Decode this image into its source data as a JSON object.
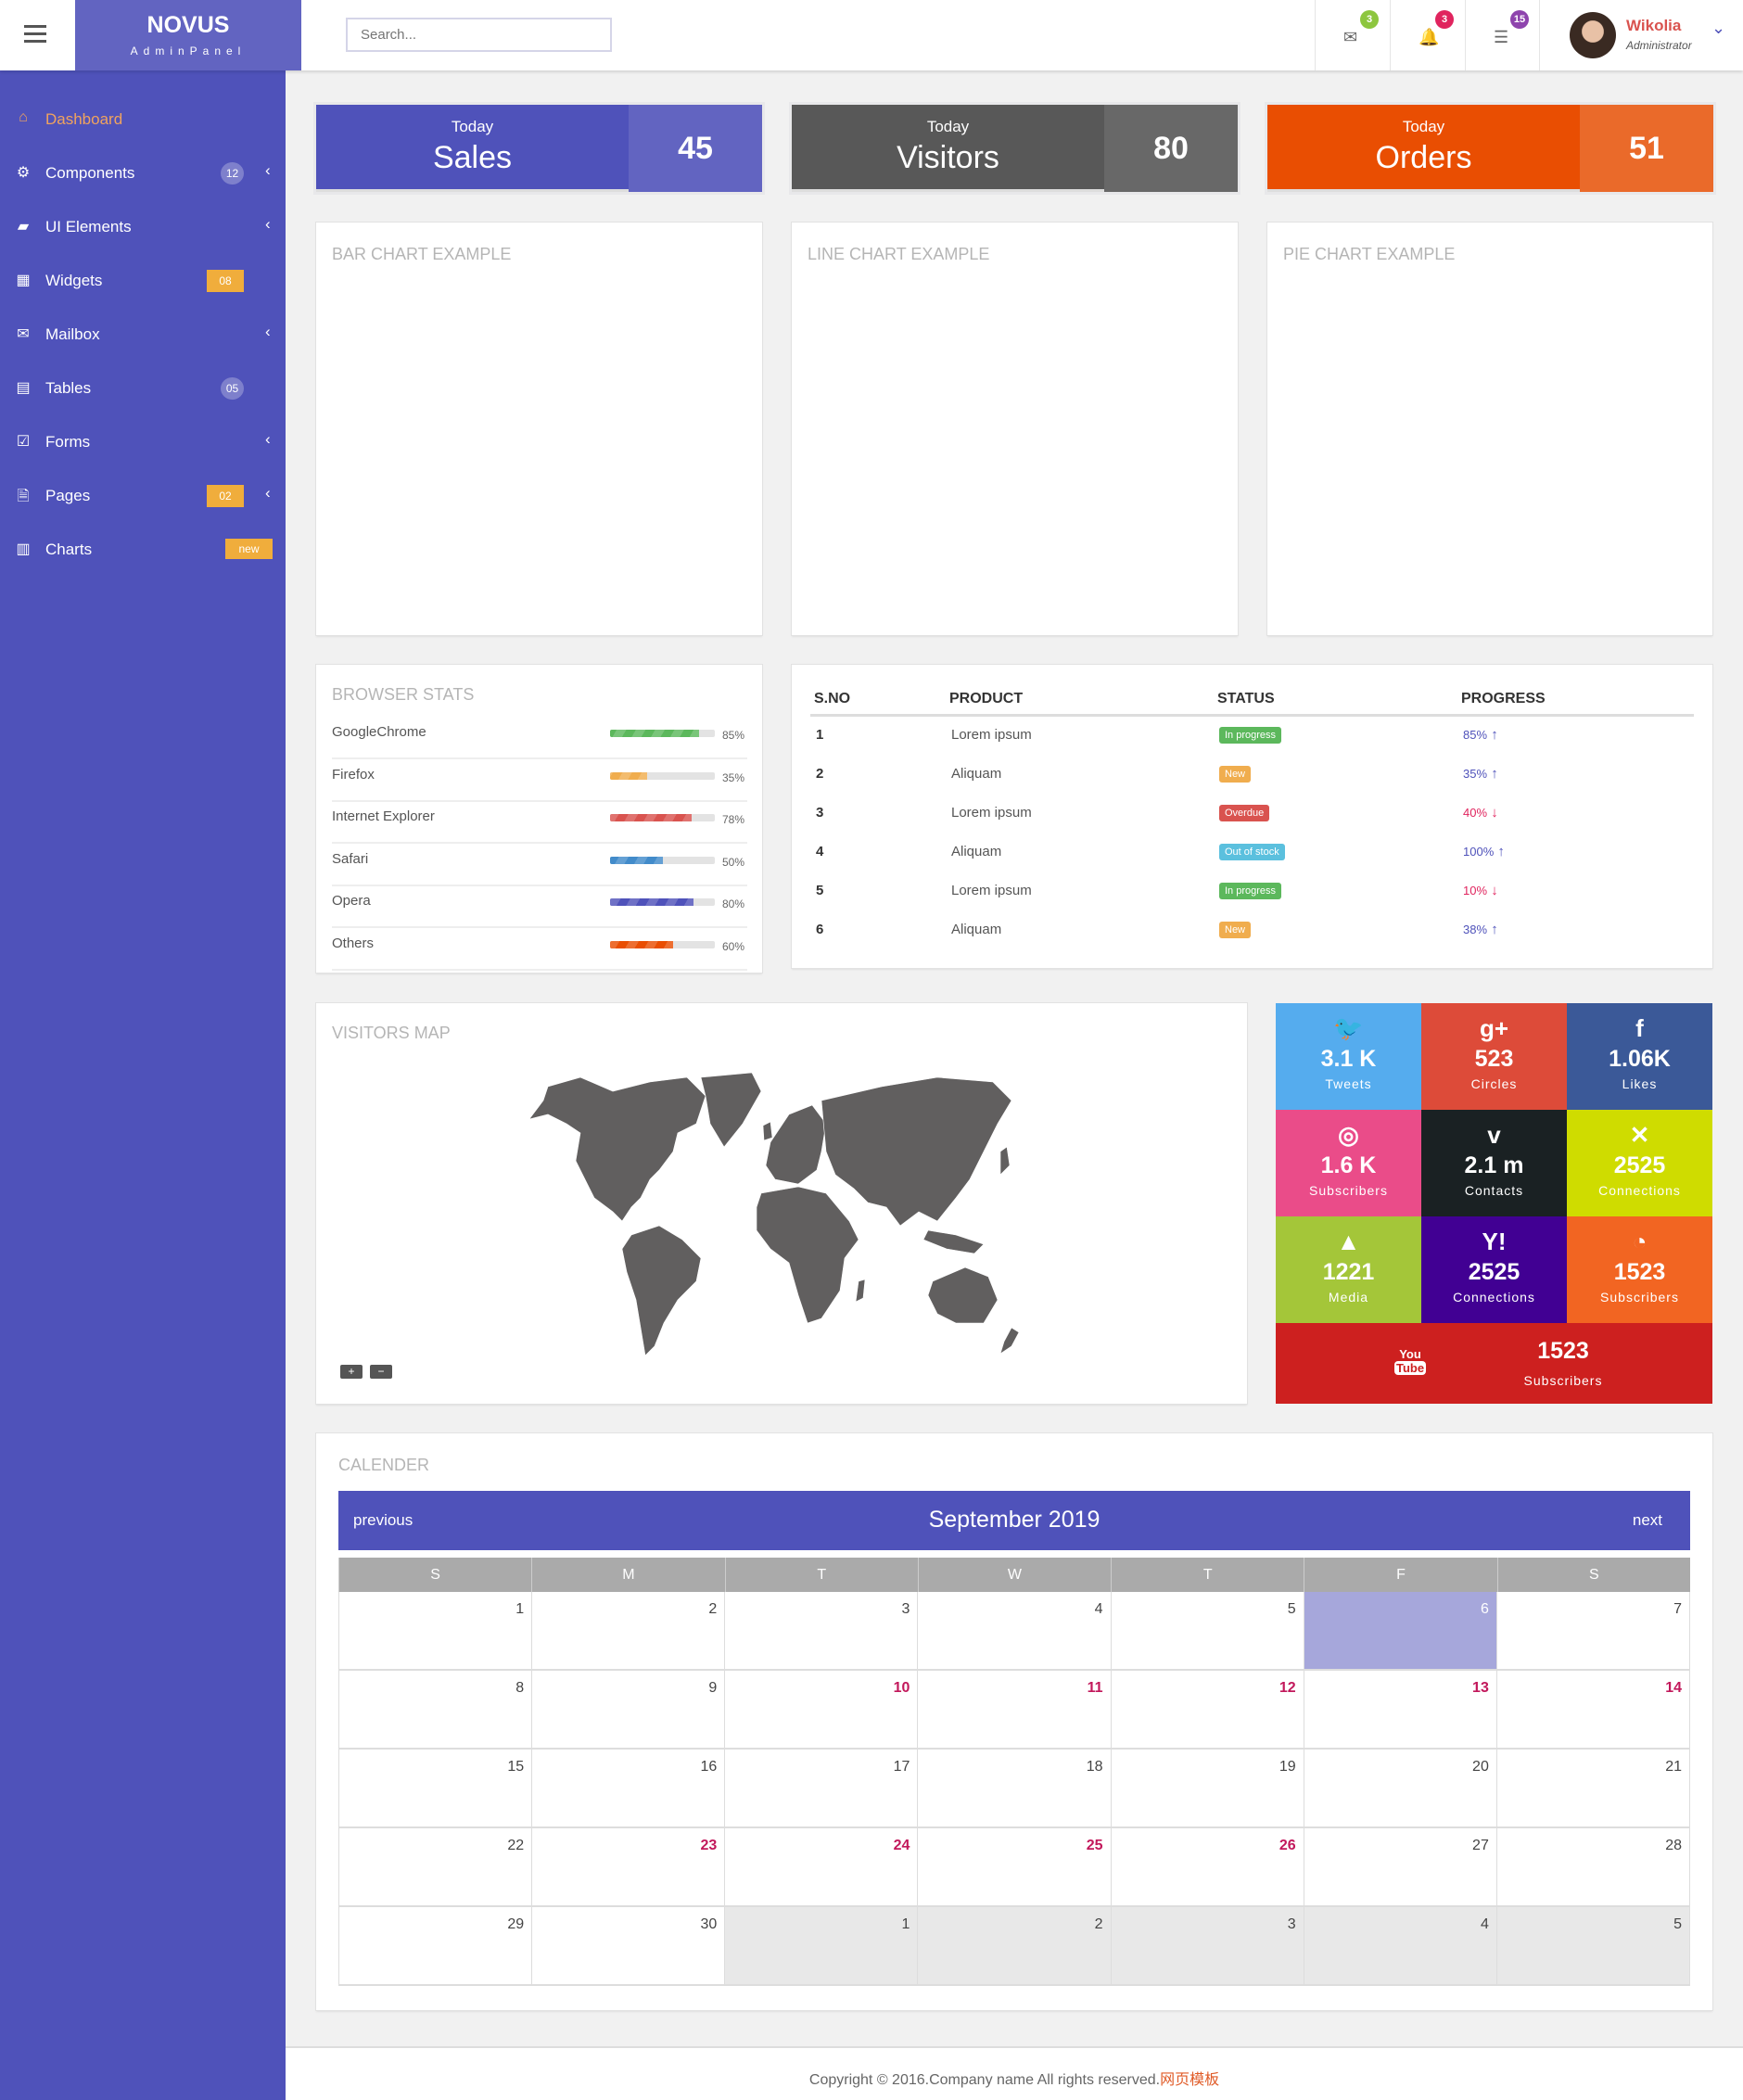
{
  "header": {
    "logo_title": "NOVUS",
    "logo_subtitle": "AdminPanel",
    "search_placeholder": "Search...",
    "notifications": [
      {
        "icon": "envelope-icon",
        "count": "3",
        "color": "#8dc63f"
      },
      {
        "icon": "bell-icon",
        "count": "3",
        "color": "#e0245e"
      },
      {
        "icon": "tasks-icon",
        "count": "15",
        "color": "#8e44ad"
      }
    ],
    "user": {
      "name": "Wikolia",
      "role": "Administrator"
    }
  },
  "sidebar": {
    "items": [
      {
        "label": "Dashboard",
        "icon": "home-icon",
        "active": true
      },
      {
        "label": "Components",
        "icon": "cogs-icon",
        "badge": "12",
        "badge_style": "round",
        "chevron": true
      },
      {
        "label": "UI Elements",
        "icon": "book-icon",
        "chevron": true
      },
      {
        "label": "Widgets",
        "icon": "th-large-icon",
        "badge": "08",
        "badge_style": "sq"
      },
      {
        "label": "Mailbox",
        "icon": "envelope-icon",
        "chevron": true
      },
      {
        "label": "Tables",
        "icon": "table-icon",
        "badge": "05",
        "badge_style": "round"
      },
      {
        "label": "Forms",
        "icon": "check-square-icon",
        "chevron": true
      },
      {
        "label": "Pages",
        "icon": "file-icon",
        "badge": "02",
        "badge_style": "sq",
        "chevron": true
      },
      {
        "label": "Charts",
        "icon": "bar-chart-icon",
        "badge": "new",
        "badge_style": "new"
      }
    ]
  },
  "stats": [
    {
      "caption": "Today",
      "label": "Sales",
      "value": "45",
      "color": "#4f52ba",
      "accent": "#6264c1"
    },
    {
      "caption": "Today",
      "label": "Visitors",
      "value": "80",
      "color": "#585858",
      "accent": "#686868"
    },
    {
      "caption": "Today",
      "label": "Orders",
      "value": "51",
      "color": "#e94e02",
      "accent": "#ea6a2a"
    }
  ],
  "charts": {
    "bar_title": "BAR CHART EXAMPLE",
    "line_title": "LINE CHART EXAMPLE",
    "pie_title": "PIE CHART EXAMPLE"
  },
  "browser_stats": {
    "title": "BROWSER STATS",
    "rows": [
      {
        "name": "GoogleChrome",
        "percent": 85,
        "label": "85%",
        "color": "#5cb85c"
      },
      {
        "name": "Firefox",
        "percent": 35,
        "label": "35%",
        "color": "#f0ad4e"
      },
      {
        "name": "Internet Explorer",
        "percent": 78,
        "label": "78%",
        "color": "#d9534f"
      },
      {
        "name": "Safari",
        "percent": 50,
        "label": "50%",
        "color": "#428bca"
      },
      {
        "name": "Opera",
        "percent": 80,
        "label": "80%",
        "color": "#4f52ba"
      },
      {
        "name": "Others",
        "percent": 60,
        "label": "60%",
        "color": "#e94e02"
      }
    ]
  },
  "products_table": {
    "columns": [
      "S.NO",
      "PRODUCT",
      "STATUS",
      "PROGRESS"
    ],
    "rows": [
      {
        "sno": "1",
        "product": "Lorem ipsum",
        "status": "In progress",
        "status_color": "#5cb85c",
        "progress": "85%",
        "trend": "up"
      },
      {
        "sno": "2",
        "product": "Aliquam",
        "status": "New",
        "status_color": "#f0ad4e",
        "progress": "35%",
        "trend": "up"
      },
      {
        "sno": "3",
        "product": "Lorem ipsum",
        "status": "Overdue",
        "status_color": "#d9534f",
        "progress": "40%",
        "trend": "down"
      },
      {
        "sno": "4",
        "product": "Aliquam",
        "status": "Out of stock",
        "status_color": "#5bc0de",
        "progress": "100%",
        "trend": "up"
      },
      {
        "sno": "5",
        "product": "Lorem ipsum",
        "status": "In progress",
        "status_color": "#5cb85c",
        "progress": "10%",
        "trend": "down"
      },
      {
        "sno": "6",
        "product": "Aliquam",
        "status": "New",
        "status_color": "#f0ad4e",
        "progress": "38%",
        "trend": "up"
      }
    ]
  },
  "visitors_map": {
    "title": "VISITORS MAP",
    "zoom_in": "+",
    "zoom_out": "−"
  },
  "social": [
    {
      "icon": "twitter-icon",
      "glyph": "🐦",
      "value": "3.1 K",
      "caption": "Tweets",
      "color": "#55acee"
    },
    {
      "icon": "google-plus-icon",
      "glyph": "g+",
      "value": "523",
      "caption": "Circles",
      "color": "#dd4b39"
    },
    {
      "icon": "facebook-icon",
      "glyph": "f",
      "value": "1.06K",
      "caption": "Likes",
      "color": "#3b5998"
    },
    {
      "icon": "dribbble-icon",
      "glyph": "◎",
      "value": "1.6 K",
      "caption": "Subscribers",
      "color": "#ea4c89"
    },
    {
      "icon": "vimeo-icon",
      "glyph": "v",
      "value": "2.1 m",
      "caption": "Contacts",
      "color": "#1a2123"
    },
    {
      "icon": "xing-icon",
      "glyph": "✕",
      "value": "2525",
      "caption": "Connections",
      "color": "#cfdc00"
    },
    {
      "icon": "android-icon",
      "glyph": "▲",
      "value": "1221",
      "caption": "Media",
      "color": "#a4c639"
    },
    {
      "icon": "yahoo-icon",
      "glyph": "Y!",
      "value": "2525",
      "caption": "Connections",
      "color": "#410093"
    },
    {
      "icon": "rss-icon",
      "glyph": "◔",
      "value": "1523",
      "caption": "Subscribers",
      "color": "#f26522"
    },
    {
      "icon": "youtube-icon",
      "glyph": "You Tube",
      "value": "1523",
      "caption": "Subscribers",
      "color": "#cd201f"
    }
  ],
  "calendar": {
    "title": "CALENDER",
    "month": "September 2019",
    "prev": "previous",
    "next": "next",
    "weekdays": [
      "S",
      "M",
      "T",
      "W",
      "T",
      "F",
      "S"
    ],
    "weeks": [
      [
        {
          "d": "1"
        },
        {
          "d": "2"
        },
        {
          "d": "3"
        },
        {
          "d": "4"
        },
        {
          "d": "5"
        },
        {
          "d": "6",
          "s": "today"
        },
        {
          "d": "7"
        }
      ],
      [
        {
          "d": "8"
        },
        {
          "d": "9"
        },
        {
          "d": "10",
          "s": "red"
        },
        {
          "d": "11",
          "s": "red"
        },
        {
          "d": "12",
          "s": "red"
        },
        {
          "d": "13",
          "s": "red"
        },
        {
          "d": "14",
          "s": "red"
        }
      ],
      [
        {
          "d": "15"
        },
        {
          "d": "16"
        },
        {
          "d": "17"
        },
        {
          "d": "18"
        },
        {
          "d": "19"
        },
        {
          "d": "20"
        },
        {
          "d": "21"
        }
      ],
      [
        {
          "d": "22"
        },
        {
          "d": "23",
          "s": "red"
        },
        {
          "d": "24",
          "s": "red"
        },
        {
          "d": "25",
          "s": "red"
        },
        {
          "d": "26",
          "s": "red"
        },
        {
          "d": "27"
        },
        {
          "d": "28"
        }
      ],
      [
        {
          "d": "29"
        },
        {
          "d": "30"
        },
        {
          "d": "1",
          "s": "other"
        },
        {
          "d": "2",
          "s": "other"
        },
        {
          "d": "3",
          "s": "other"
        },
        {
          "d": "4",
          "s": "other"
        },
        {
          "d": "5",
          "s": "other"
        }
      ]
    ]
  },
  "footer": {
    "text": "Copyright © 2016.Company name All rights reserved.",
    "link": "网页模板"
  }
}
